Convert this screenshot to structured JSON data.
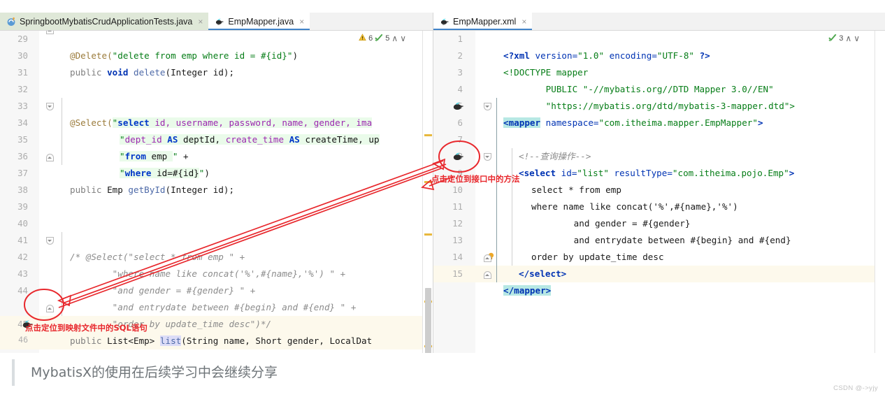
{
  "window": {
    "watermark": "CSDN @->yjy"
  },
  "left_pane": {
    "tabs": [
      {
        "label": "SpringbootMybatisCrudApplicationTests.java",
        "icon": "java-class-icon",
        "active": false,
        "close": "×"
      },
      {
        "label": "EmpMapper.java",
        "icon": "mybatis-bird-icon",
        "active": true,
        "close": "×"
      }
    ],
    "inspection": {
      "warning_icon": "warning-triangle-icon",
      "warning_count": "6",
      "ok_icon": "inspection-check-icon",
      "ok_count": "5",
      "prev_icon": "chevron-up-icon",
      "next_icon": "chevron-down-icon",
      "prev": "∧",
      "next": "∨"
    },
    "lines": [
      {
        "n": "29"
      },
      {
        "n": "30"
      },
      {
        "n": "31"
      },
      {
        "n": "32"
      },
      {
        "n": "33"
      },
      {
        "n": "34"
      },
      {
        "n": "35"
      },
      {
        "n": "36"
      },
      {
        "n": "37"
      },
      {
        "n": "38"
      },
      {
        "n": "39"
      },
      {
        "n": "40"
      },
      {
        "n": "41"
      },
      {
        "n": "42"
      },
      {
        "n": "43"
      },
      {
        "n": "44"
      },
      {
        "n": "45"
      },
      {
        "n": "46"
      },
      {
        "n": "47"
      }
    ],
    "code": {
      "l29_anno": "@Delete(",
      "l29_str": "\"delete from emp where id = #{id}\"",
      "l29_end": ")",
      "l30_a": "public ",
      "l30_b": "void ",
      "l30_c": "delete",
      "l30_d": "(Integer id);",
      "l33_anno": "@Select(",
      "l33_q": "\"",
      "l33_sql_kw": "select ",
      "l33_sql_rest": "id, username, password, name, gender, ima",
      "l34_q": "\"",
      "l34_a": "dept_id ",
      "l34_as1": "AS ",
      "l34_b": "deptId, ",
      "l34_c": "create_time ",
      "l34_as2": "AS ",
      "l34_d": "createTime, up",
      "l35_q": "\"",
      "l35_kw": "from ",
      "l35_t": "emp ",
      "l35_qe": "\"",
      "l35_plus": " +",
      "l36_q": "\"",
      "l36_kw": "where ",
      "l36_rest": "id=#{id}",
      "l36_qe": "\"",
      "l36_end": ")",
      "l37_a": "public ",
      "l37_b": "Emp ",
      "l37_c": "getById",
      "l37_d": "(Integer id);",
      "l40": "/* @Select(\"select * from emp \" +",
      "l41": "        \"where name like concat('%',#{name},'%') \" +",
      "l42": "        \"and gender = #{gender} \" +",
      "l43": "        \"and entrydate between #{begin} and #{end} \" +",
      "l44": "        \"order by update_time desc\")*/",
      "l45_a": "public ",
      "l45_b": "List<Emp> ",
      "l45_c": "list",
      "l45_d": "(String name, Short gender, LocalDat",
      "l47": "}"
    },
    "gutter_icons": [
      {
        "name": "mybatis-navigate-icon",
        "line": "45"
      }
    ]
  },
  "right_pane": {
    "tabs": [
      {
        "label": "EmpMapper.xml",
        "icon": "mybatis-bird-icon",
        "active": true,
        "close": "×"
      }
    ],
    "inspection": {
      "ok_icon": "inspection-check-icon",
      "ok_count": "3",
      "prev": "∧",
      "next": "∨"
    },
    "lines": [
      {
        "n": "1"
      },
      {
        "n": "2"
      },
      {
        "n": "3"
      },
      {
        "n": "4"
      },
      {
        "n": "5"
      },
      {
        "n": "6"
      },
      {
        "n": "7"
      },
      {
        "n": "8"
      },
      {
        "n": "9"
      },
      {
        "n": "10"
      },
      {
        "n": "11"
      },
      {
        "n": "12"
      },
      {
        "n": "13"
      },
      {
        "n": "14"
      },
      {
        "n": "15"
      }
    ],
    "code": {
      "l1_a": "<?xml ",
      "l1_b": "version=",
      "l1_c": "\"1.0\" ",
      "l1_d": "encoding=",
      "l1_e": "\"UTF-8\" ",
      "l1_f": "?>",
      "l2": "<!DOCTYPE mapper",
      "l3": "        PUBLIC \"-//mybatis.org//DTD Mapper 3.0//EN\"",
      "l4": "        \"https://mybatis.org/dtd/mybatis-3-mapper.dtd\">",
      "l5_tag": "<mapper",
      "l5_attr": " namespace=",
      "l5_val": "\"com.itheima.mapper.EmpMapper\"",
      "l5_end": ">",
      "l7_cmt": "<!--查询操作-->",
      "l8_tag": "<select ",
      "l8_a1": "id=",
      "l8_v1": "\"list\" ",
      "l8_a2": "resultType=",
      "l8_v2": "\"com.itheima.pojo.Emp\"",
      "l8_end": ">",
      "l9": "select * from emp",
      "l10": "where name like concat('%',#{name},'%')",
      "l11": "        and gender = #{gender}",
      "l12": "        and entrydate between #{begin} and #{end}",
      "l13": "order by update_time desc",
      "l14": "</select>",
      "l15": "</mapper>"
    },
    "gutter_icons": [
      {
        "name": "mybatis-navigate-icon",
        "line": "5"
      },
      {
        "name": "mybatis-navigate-icon",
        "line": "8"
      }
    ],
    "bulb": {
      "name": "intention-bulb-icon",
      "line": "14"
    }
  },
  "annotations": {
    "left_note": "点击定位到映射文件中的SQL语句",
    "right_note": "点击定位到接口中的方法",
    "accent_color": "#e8282d"
  },
  "caption": {
    "text": "MybatisX的使用在后续学习中会继续分享"
  }
}
